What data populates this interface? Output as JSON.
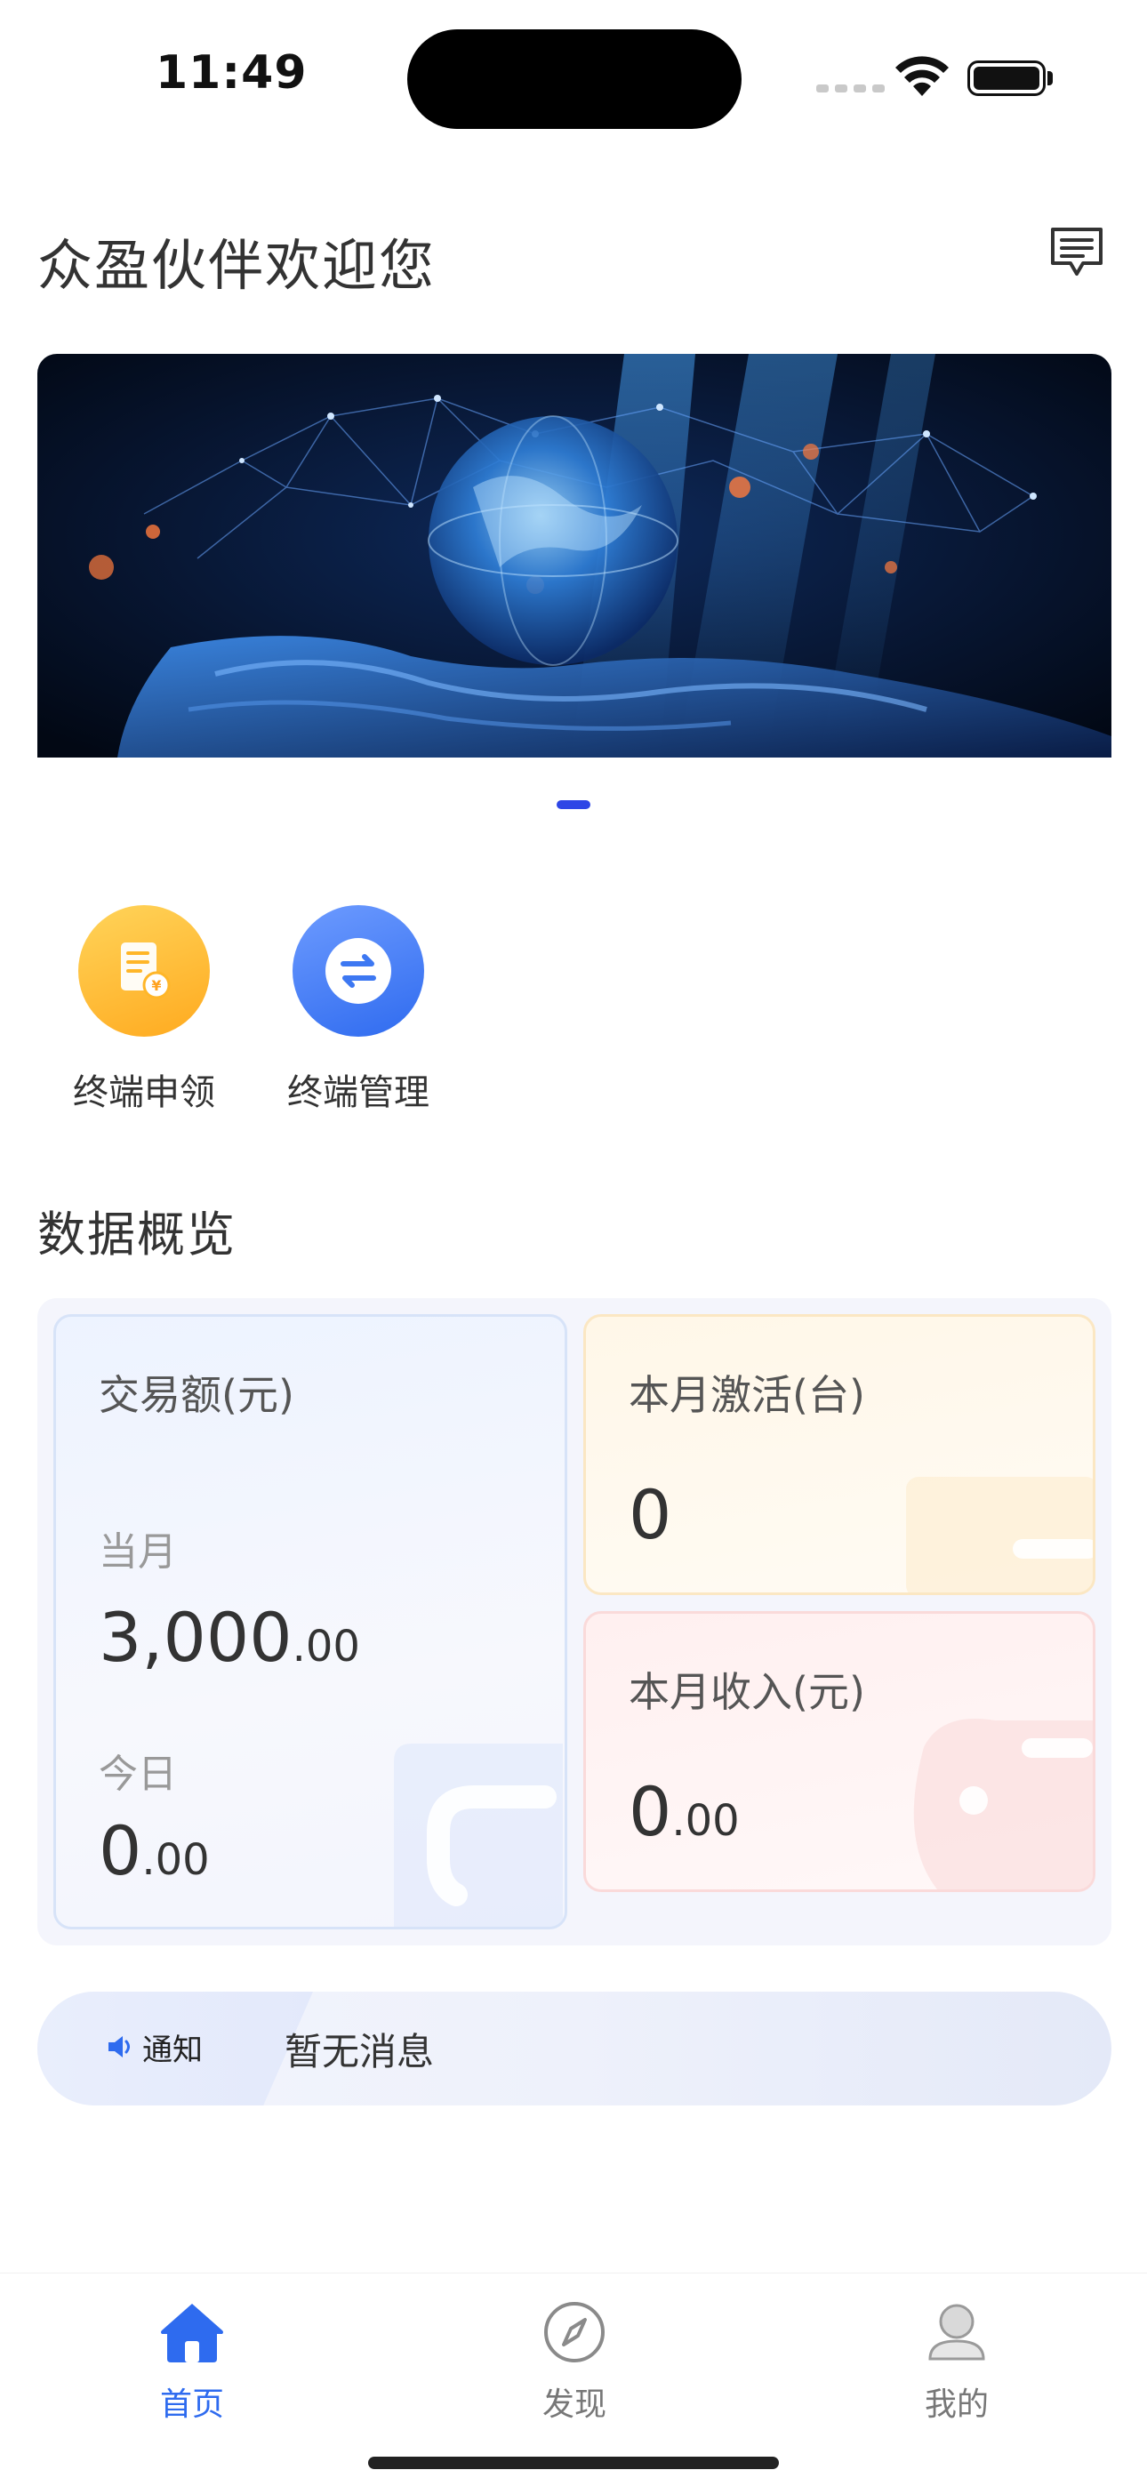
{
  "status_bar": {
    "time": "11:49"
  },
  "header": {
    "title": "众盈伙伴欢迎您",
    "message_icon": "message-icon"
  },
  "banner": {
    "image": "globe-in-hands-illustration",
    "slide_indicator_active": 1
  },
  "shortcuts": [
    {
      "label": "终端申领",
      "icon": "document-yuan-icon",
      "color": "#ffb628"
    },
    {
      "label": "终端管理",
      "icon": "exchange-arrows-icon",
      "color": "#3d78f2"
    }
  ],
  "overview": {
    "title": "数据概览",
    "transaction": {
      "title": "交易额(元)",
      "month_label": "当月",
      "month_int": "3,000",
      "month_dec": ".00",
      "today_label": "今日",
      "today_int": "0",
      "today_dec": ".00"
    },
    "activation": {
      "title": "本月激活(台)",
      "value": "0"
    },
    "income": {
      "title": "本月收入(元)",
      "value_int": "0",
      "value_dec": ".00"
    }
  },
  "notice": {
    "tag": "通知",
    "text": "暂无消息"
  },
  "tabbar": {
    "items": [
      {
        "label": "首页",
        "icon": "home-icon",
        "active": true
      },
      {
        "label": "发现",
        "icon": "compass-icon",
        "active": false
      },
      {
        "label": "我的",
        "icon": "user-icon",
        "active": false
      }
    ],
    "active_color": "#2e6bef"
  }
}
